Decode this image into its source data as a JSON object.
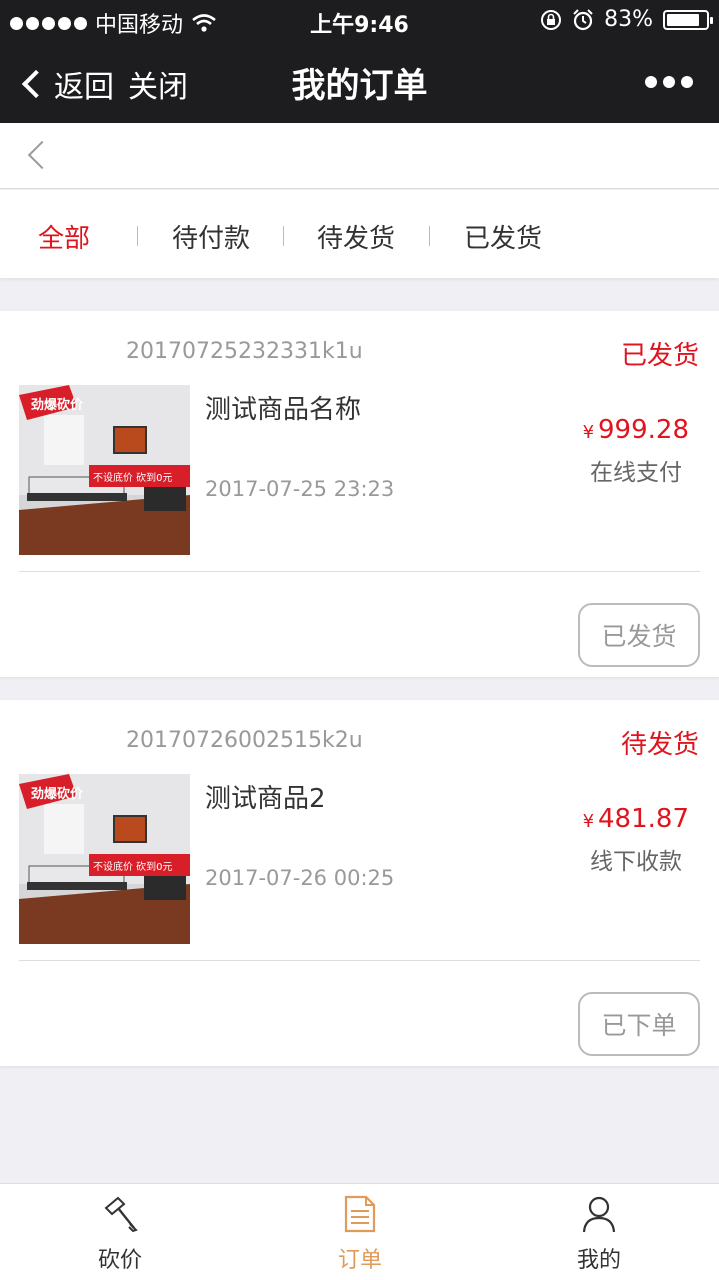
{
  "status_bar": {
    "carrier": "中国移动",
    "time": "上午9:46",
    "battery": "83%",
    "battery_level": 0.83
  },
  "nav": {
    "back_label": "返回",
    "close_label": "关闭",
    "title": "我的订单"
  },
  "tabs": [
    {
      "label": "全部",
      "active": true
    },
    {
      "label": "待付款",
      "active": false
    },
    {
      "label": "待发货",
      "active": false
    },
    {
      "label": "已发货",
      "active": false
    }
  ],
  "orders": [
    {
      "order_no": "20170725232331k1u",
      "status": "已发货",
      "product_name": "测试商品名称",
      "date": "2017-07-25 23:23",
      "currency": "¥",
      "price": "999.28",
      "payment": "在线支付",
      "action": "已发货",
      "image_text": {
        "badge": "劲爆砍价",
        "banner": "不设底价 砍到0元"
      }
    },
    {
      "order_no": "20170726002515k2u",
      "status": "待发货",
      "product_name": "测试商品2",
      "date": "2017-07-26 00:25",
      "currency": "¥",
      "price": "481.87",
      "payment": "线下收款",
      "action": "已下单",
      "image_text": {
        "badge": "劲爆砍价",
        "banner": "不设底价 砍到0元"
      }
    }
  ],
  "tabbar": [
    {
      "label": "砍价",
      "icon": "axe-icon",
      "active": false
    },
    {
      "label": "订单",
      "icon": "document-icon",
      "active": true
    },
    {
      "label": "我的",
      "icon": "user-icon",
      "active": false
    }
  ],
  "colors": {
    "accent_red": "#e0141e",
    "tabbar_active": "#e09a5a",
    "nav_bg": "#1d1d1f"
  }
}
